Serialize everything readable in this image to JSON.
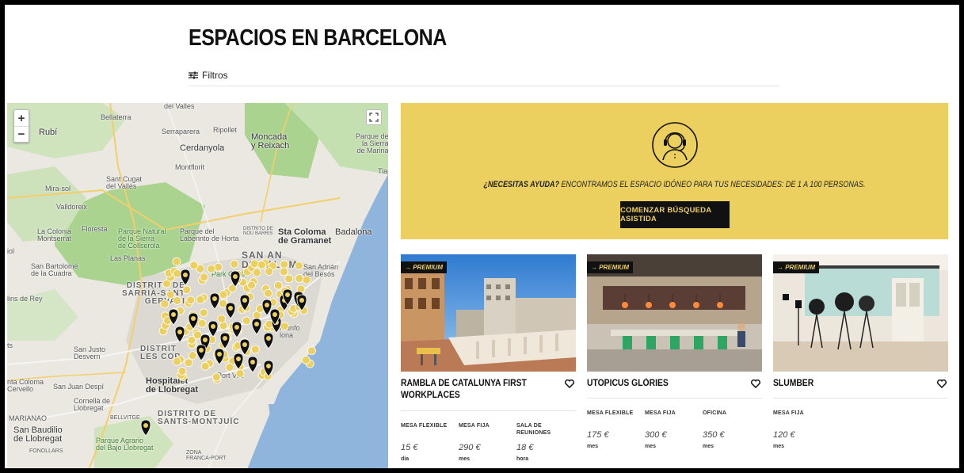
{
  "page": {
    "title": "ESPACIOS EN BARCELONA",
    "filters_label": "Filtros"
  },
  "map": {
    "zoom_in": "+",
    "zoom_out": "−",
    "labels": {
      "bellaterra": "Bellaterra",
      "rubi": "Rubí",
      "serraparera": "Serraparera",
      "ripollet": "Ripollet",
      "moncada": "Moncada\ny Reixach",
      "parque_marina": "Parque de\nla Sierra\nde Marina",
      "cerdanyola": "Cerdanyola",
      "montflorit": "Montflorit",
      "sant_cugat": "Sant Cugat\ndel Vallès",
      "mira_sol": "Mira-sol",
      "valldoreix": "Valldoreix",
      "tiana": "Tian",
      "la_colonia": "La Colonia\nMontserrat",
      "floresta": "Floresta",
      "parque_natural": "Parque Natural\nde la Sierra\nde Collserola",
      "parque_laberinto": "Parque del\nLaberinto de Horta",
      "distrito_nou_barris": "DISTRITO DE\nNOU BARRIS",
      "sta_coloma": "Sta Coloma\nde Gramanet",
      "badalona": "Badalona",
      "las_planas": "Las Planas",
      "sant_andreu": "SAN AN\nDE PALOM",
      "sant_adria": "San Adrián\ndel Besós",
      "sant_bartolome": "San Bartolomé\nde la Cuadra",
      "park_guell": "Park Güell",
      "sarria": "DISTRITO DE\nSARRIÀ-SANT\nGERVASI",
      "molins": "lins de Rey",
      "sant_joan": "San Justo\nDesvern",
      "les_corts": "DISTRIT\nLES COR",
      "triunfo": "rriunfo\nlona",
      "santa_coloma_cervello": "nta Coloma\nCervello",
      "sant_joan_despi": "San Juan Despí",
      "hospitalet": "Hospitalet\nde Llobregat",
      "cornella": "Cornellà de\nLlobregat",
      "marianao": "MARIANAO",
      "bellvitge": "BELLVITGE",
      "sants": "DISTRITO DE\nSANTS-MONTJUÏC",
      "sant_boi": "San Baudilio\nde Llobregat",
      "parque_agrario": "Parque Agrario\ndel Bajo Llobregat",
      "fonollars": "FONOLLARS",
      "zona_franca": "ZONA\nFRANCA-PORT",
      "port_vell": "Port Vell",
      "iol": "iol",
      "ts": "ts",
      "del_valles": "del Valles"
    }
  },
  "help": {
    "question": "¿NECESITAS AYUDA?",
    "message": " ENCONTRAMOS EL ESPACIO IDÓNEO PARA TUS NECESIDADES: DE 1 A 100 PERSONAS.",
    "button": "COMENZAR BÚSQUEDA ASISTIDA"
  },
  "cards": [
    {
      "badge": "→ PREMIUM",
      "title": "RAMBLA DE CATALUNYA FIRST WORKPLACES",
      "prices": [
        {
          "label": "MESA FLEXIBLE",
          "value": "15 €",
          "unit": "día"
        },
        {
          "label": "MESA FIJA",
          "value": "290 €",
          "unit": "mes"
        },
        {
          "label": "SALA DE REUNIONES",
          "value": "18 €",
          "unit": "hora"
        }
      ]
    },
    {
      "badge": "→ PREMIUM",
      "title": "UTOPICUS GLÒRIES",
      "prices": [
        {
          "label": "MESA FLEXIBLE",
          "value": "175 €",
          "unit": "mes"
        },
        {
          "label": "MESA FIJA",
          "value": "300 €",
          "unit": "mes"
        },
        {
          "label": "OFICINA",
          "value": "350 €",
          "unit": "mes"
        }
      ]
    },
    {
      "badge": "→ PREMIUM",
      "title": "SLUMBER",
      "prices": [
        {
          "label": "MESA FIJA",
          "value": "120 €",
          "unit": "mes"
        }
      ]
    }
  ],
  "colors": {
    "accent": "#ebcf5f",
    "dark": "#111111",
    "water": "#8fb5dc",
    "park": "#b9dba3"
  }
}
